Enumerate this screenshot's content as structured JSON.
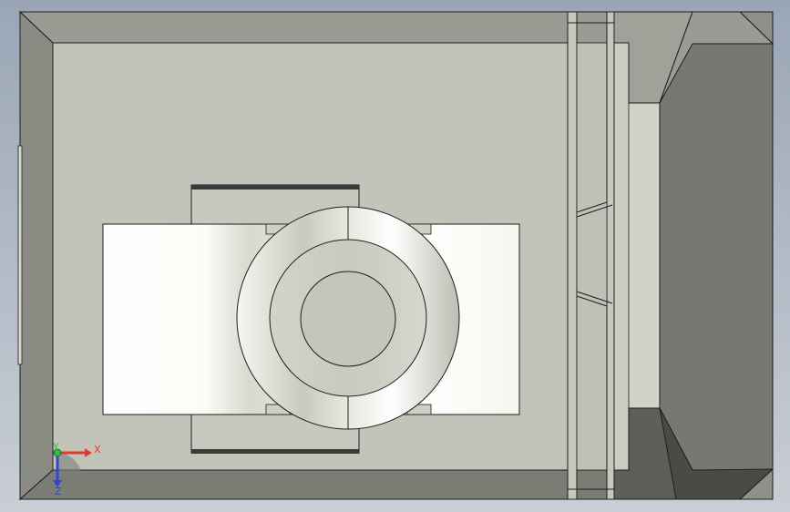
{
  "viewport": {
    "background_top": "#9aa6b6",
    "background_bottom": "#c9ced6"
  },
  "part": {
    "outer_frame_color": "#8e8f86",
    "dark_frame_color": "#5f605a",
    "plate_color": "#c2c2b8",
    "inner_block_color": "#f4f4ee",
    "edge_color": "#1e1e1e"
  },
  "triad": {
    "x_label": "X",
    "y_label": "Y",
    "z_label": "Z",
    "x_color": "#e23a2f",
    "y_color": "#2fbf3a",
    "z_color": "#2f47d6"
  }
}
